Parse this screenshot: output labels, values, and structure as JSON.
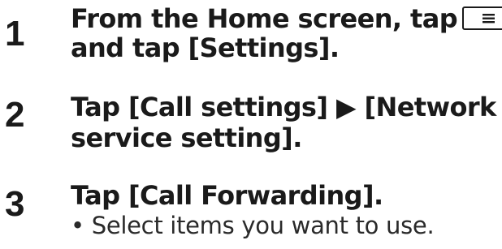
{
  "steps": [
    {
      "number": "1",
      "line1": "From the Home screen, tap",
      "line1_icon": "menu-key-icon",
      "line2": "and tap [Settings]."
    },
    {
      "number": "2",
      "line1": "Tap [Call settings] ▶ [Network",
      "line2": "service setting]."
    },
    {
      "number": "3",
      "line1": "Tap [Call Forwarding].",
      "note": "• Select items you want to use."
    }
  ]
}
